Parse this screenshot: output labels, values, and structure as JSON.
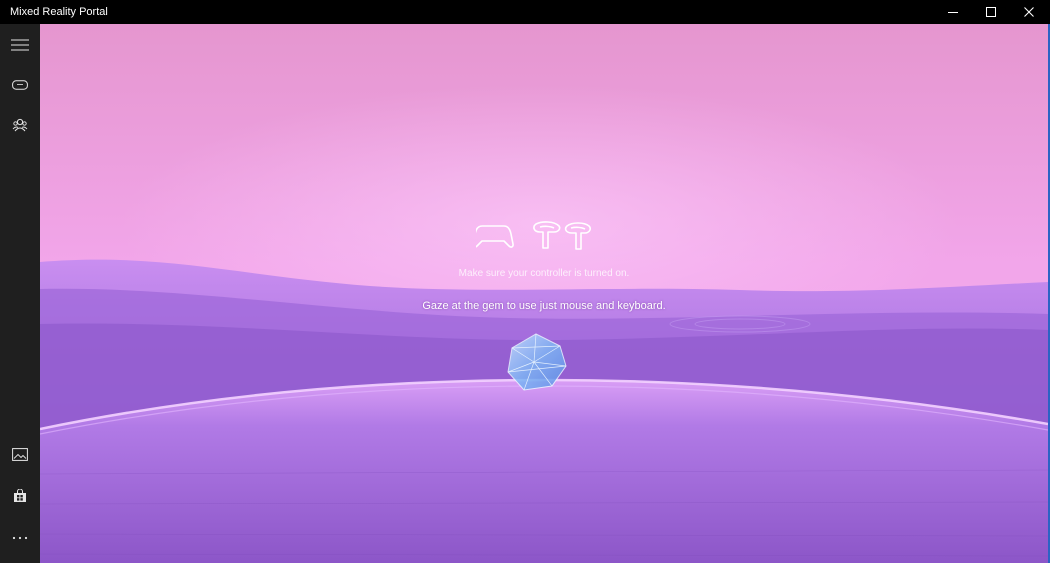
{
  "window": {
    "title": "Mixed Reality Portal"
  },
  "title_bar_buttons": [
    {
      "name": "minimize",
      "icon": "minimize-icon"
    },
    {
      "name": "maximize",
      "icon": "maximize-icon"
    },
    {
      "name": "close",
      "icon": "close-icon"
    }
  ],
  "sidebar": {
    "items": [
      {
        "name": "menu",
        "icon": "hamburger-menu-icon"
      },
      {
        "name": "headset",
        "icon": "headset-icon"
      },
      {
        "name": "people",
        "icon": "people-icon"
      },
      {
        "name": "gallery",
        "icon": "picture-icon"
      },
      {
        "name": "store",
        "icon": "store-icon"
      },
      {
        "name": "more",
        "icon": "more-icon"
      }
    ]
  },
  "stage": {
    "controller_hint": "Make sure your controller is turned on.",
    "gaze_hint": "Gaze at the gem to use just mouse and keyboard.",
    "icons": [
      "gamepad-icon",
      "motion-controller-icon",
      "motion-controller-icon"
    ]
  },
  "colors": {
    "sky_top": "#e796cf",
    "sky_bottom": "#f3a8ee",
    "horizon": "#a873e0",
    "floor": "#9a62d6",
    "accent_border": "#2b63c4",
    "sidebar": "#1f1f1f",
    "titlebar": "#000000"
  }
}
